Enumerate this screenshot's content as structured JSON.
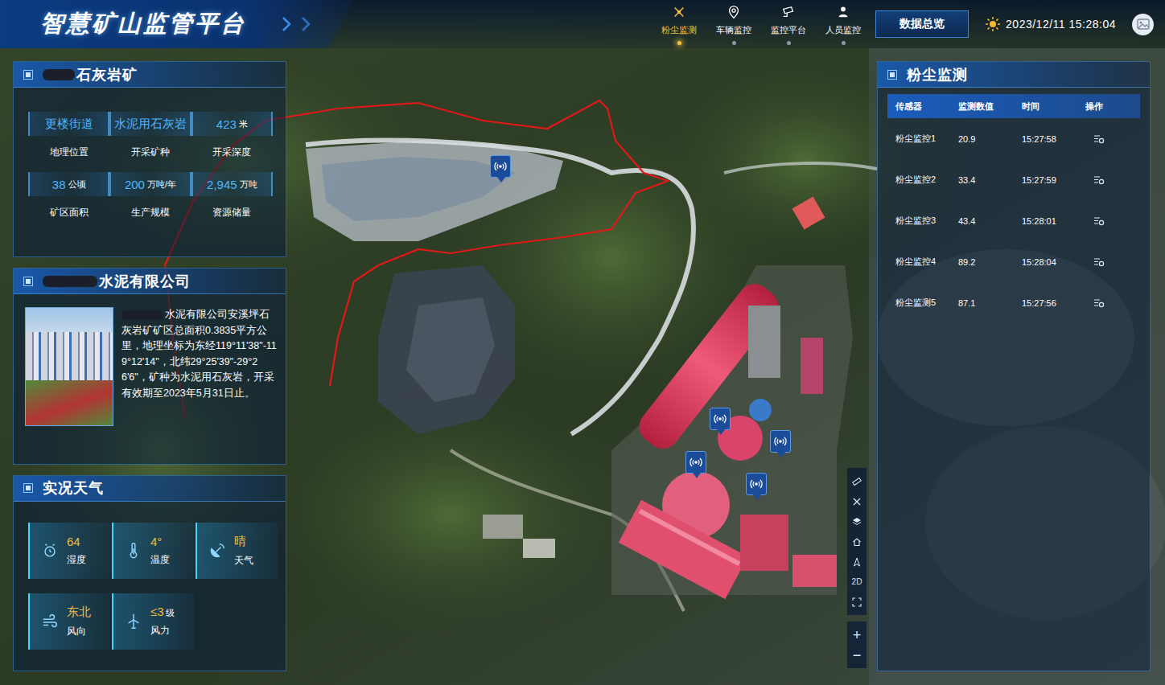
{
  "header": {
    "title": "智慧矿山监管平台",
    "nav": [
      {
        "label": "粉尘监测",
        "kind": "dust",
        "selected": true
      },
      {
        "label": "车辆监控",
        "kind": "vehicle",
        "selected": false
      },
      {
        "label": "监控平台",
        "kind": "camera",
        "selected": false
      },
      {
        "label": "人员监控",
        "kind": "person",
        "selected": false
      }
    ],
    "overview_button": "数据总览",
    "datetime": "2023/12/11 15:28:04"
  },
  "mine": {
    "title": "石灰岩矿",
    "stats": [
      {
        "value": "更楼街道",
        "unit": "",
        "label": "地理位置"
      },
      {
        "value": "水泥用石灰岩",
        "unit": "",
        "label": "开采矿种"
      },
      {
        "value": "423",
        "unit": "米",
        "label": "开采深度"
      },
      {
        "value": "38",
        "unit": "公顷",
        "label": "矿区面积"
      },
      {
        "value": "200",
        "unit": "万吨/年",
        "label": "生产规模"
      },
      {
        "value": "2,945",
        "unit": "万吨",
        "label": "资源储量"
      }
    ]
  },
  "company": {
    "title": "水泥有限公司",
    "description": "水泥有限公司安溪坪石灰岩矿矿区总面积0.3835平方公里，地理坐标为东经119°11'38\"-119°12'14\"，北纬29°25'39\"-29°26'6\"，矿种为水泥用石灰岩，开采有效期至2023年5月31日止。"
  },
  "weather": {
    "title": "实况天气",
    "items": [
      {
        "value": "64",
        "unit": "",
        "label": "湿度",
        "kind": "humidity"
      },
      {
        "value": "4°",
        "unit": "",
        "label": "温度",
        "kind": "temperature"
      },
      {
        "value": "晴",
        "unit": "",
        "label": "天气",
        "kind": "sky"
      },
      {
        "value": "东北",
        "unit": "",
        "label": "风向",
        "kind": "wind-direction"
      },
      {
        "value": "≤3",
        "unit": "级",
        "label": "风力",
        "kind": "wind-force"
      }
    ]
  },
  "dust": {
    "title": "粉尘监测",
    "columns": [
      "传感器",
      "监测数值",
      "时间",
      "操作"
    ],
    "rows": [
      {
        "sensor": "粉尘监控1",
        "value": "20.9",
        "time": "15:27:58"
      },
      {
        "sensor": "粉尘监控2",
        "value": "33.4",
        "time": "15:27:59"
      },
      {
        "sensor": "粉尘监控3",
        "value": "43.4",
        "time": "15:28:01"
      },
      {
        "sensor": "粉尘监控4",
        "value": "89.2",
        "time": "15:28:04"
      },
      {
        "sensor": "粉尘监测5",
        "value": "87.1",
        "time": "15:27:56"
      }
    ]
  },
  "map_tools": {
    "mode": "2D",
    "zoom_in": "+",
    "zoom_out": "−"
  }
}
